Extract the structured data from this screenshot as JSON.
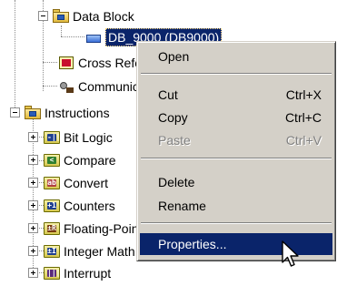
{
  "tree": {
    "data_block": "Data Block",
    "db_entry": "DB_9000 (DB9000)",
    "cross_ref": "Cross Reference",
    "communications": "Communications",
    "instructions": "Instructions",
    "bit_logic": "Bit Logic",
    "compare": "Compare",
    "convert": "Convert",
    "counters": "Counters",
    "floating_point": "Floating-Point Math",
    "integer_math": "Integer Math",
    "interrupt": "Interrupt"
  },
  "menu": {
    "open": "Open",
    "cut": "Cut",
    "cut_key": "Ctrl+X",
    "copy": "Copy",
    "copy_key": "Ctrl+C",
    "paste": "Paste",
    "paste_key": "Ctrl+V",
    "delete": "Delete",
    "rename": "Rename",
    "properties": "Properties..."
  },
  "colors": {
    "selection": "#0a246a",
    "menu_bg": "#d4d0c8",
    "disabled_text": "#808080"
  }
}
